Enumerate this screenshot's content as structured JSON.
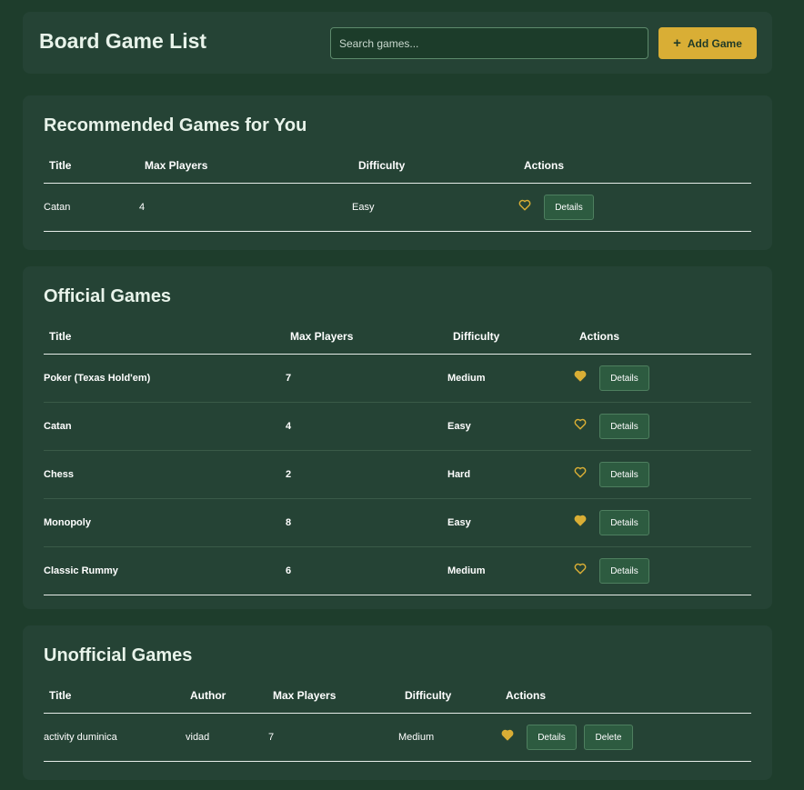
{
  "header": {
    "title": "Board Game List",
    "search_placeholder": "Search games...",
    "add_label": "Add Game"
  },
  "recommended": {
    "title": "Recommended Games for You",
    "columns": [
      "Title",
      "Max Players",
      "Difficulty",
      "Actions"
    ],
    "rows": [
      {
        "title": "Catan",
        "players": "4",
        "difficulty": "Easy",
        "favorite": false,
        "details": "Details"
      }
    ]
  },
  "official": {
    "title": "Official Games",
    "columns": [
      "Title",
      "Max Players",
      "Difficulty",
      "Actions"
    ],
    "rows": [
      {
        "title": "Poker (Texas Hold'em)",
        "players": "7",
        "difficulty": "Medium",
        "favorite": true,
        "details": "Details"
      },
      {
        "title": "Catan",
        "players": "4",
        "difficulty": "Easy",
        "favorite": false,
        "details": "Details"
      },
      {
        "title": "Chess",
        "players": "2",
        "difficulty": "Hard",
        "favorite": false,
        "details": "Details"
      },
      {
        "title": "Monopoly",
        "players": "8",
        "difficulty": "Easy",
        "favorite": true,
        "details": "Details"
      },
      {
        "title": "Classic Rummy",
        "players": "6",
        "difficulty": "Medium",
        "favorite": false,
        "details": "Details"
      }
    ]
  },
  "unofficial": {
    "title": "Unofficial Games",
    "columns": [
      "Title",
      "Author",
      "Max Players",
      "Difficulty",
      "Actions"
    ],
    "rows": [
      {
        "title": "activity duminica",
        "author": "vidad",
        "players": "7",
        "difficulty": "Medium",
        "favorite": true,
        "details": "Details",
        "delete": "Delete"
      }
    ]
  },
  "colors": {
    "background": "#1e3d2c",
    "card": "#254335",
    "accent": "#d9ae35",
    "button": "#2d5b40"
  },
  "icons": {
    "favorite_on": "heart-filled-icon",
    "favorite_off": "heart-outline-icon",
    "add": "plus-icon"
  }
}
